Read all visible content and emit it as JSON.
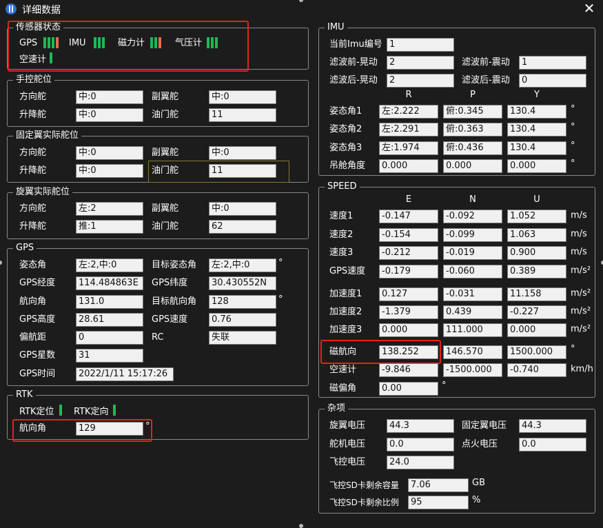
{
  "window": {
    "title": "详细数据",
    "close_glyph": "✕"
  },
  "sensor_status": {
    "title": "传感器状态",
    "gps": "GPS",
    "imu": "IMU",
    "mag": "磁力计",
    "baro": "气压计",
    "airspeed": "空速计",
    "colors": {
      "ok": "#1db954",
      "warn": "#e86a4d"
    }
  },
  "manual": {
    "title": "手控舵位",
    "rudder_label": "方向舵",
    "rudder": "中:0",
    "aileron_label": "副翼舵",
    "aileron": "中:0",
    "elevator_label": "升降舵",
    "elevator": "中:0",
    "throttle_label": "油门舵",
    "throttle": "11"
  },
  "fixed": {
    "title": "固定翼实际舵位",
    "rudder_label": "方向舵",
    "rudder": "中:0",
    "aileron_label": "副翼舵",
    "aileron": "中:0",
    "elevator_label": "升降舵",
    "elevator": "中:0",
    "throttle_label": "油门舵",
    "throttle": "11"
  },
  "rotor": {
    "title": "旋翼实际舵位",
    "rudder_label": "方向舵",
    "rudder": "左:2",
    "aileron_label": "副翼舵",
    "aileron": "中:0",
    "elevator_label": "升降舵",
    "elevator": "推:1",
    "throttle_label": "油门舵",
    "throttle": "62"
  },
  "gps": {
    "title": "GPS",
    "attitude_label": "姿态角",
    "attitude": "左:2,中:0",
    "target_attitude_label": "目标姿态角",
    "target_attitude": "左:2,中:0",
    "lon_label": "GPS经度",
    "lon": "114.484863E",
    "lat_label": "GPS纬度",
    "lat": "30.430552N",
    "heading_label": "航向角",
    "heading": "131.0",
    "target_heading_label": "目标航向角",
    "target_heading": "128",
    "alt_label": "GPS高度",
    "alt": "28.61",
    "speed_label": "GPS速度",
    "speed": "0.76",
    "offset_label": "偏航距",
    "offset": "0",
    "rc_label": "RC",
    "rc": "失联",
    "sats_label": "GPS星数",
    "sats": "31",
    "time_label": "GPS时间",
    "time": "2022/1/11 15:17:26",
    "deg": "°"
  },
  "rtk": {
    "title": "RTK",
    "pos_label": "RTK定位",
    "dir_label": "RTK定向",
    "heading_label": "航向角",
    "heading": "129",
    "deg": "°"
  },
  "imu": {
    "title": "IMU",
    "current_label": "当前Imu编号",
    "current": "1",
    "pre_shake_label": "滤波前-晃动",
    "pre_shake": "2",
    "pre_vib_label": "滤波前-震动",
    "pre_vib": "1",
    "post_shake_label": "滤波后-晃动",
    "post_shake": "2",
    "post_vib_label": "滤波后-震动",
    "post_vib": "0",
    "col_r": "R",
    "col_p": "P",
    "col_y": "Y",
    "att1_label": "姿态角1",
    "att1_r": "左:2.222",
    "att1_p": "俯:0.345",
    "att1_y": "130.4",
    "att2_label": "姿态角2",
    "att2_r": "左:2.291",
    "att2_p": "俯:0.363",
    "att2_y": "130.4",
    "att3_label": "姿态角3",
    "att3_r": "左:1.974",
    "att3_p": "俯:0.436",
    "att3_y": "130.4",
    "pod_label": "吊舱角度",
    "pod_r": "0.000",
    "pod_p": "0.000",
    "pod_y": "0.000",
    "deg": "°"
  },
  "speed": {
    "title": "SPEED",
    "col_e": "E",
    "col_n": "N",
    "col_u": "U",
    "v1_label": "速度1",
    "v1_e": "-0.147",
    "v1_n": "-0.092",
    "v1_u": "1.052",
    "v2_label": "速度2",
    "v2_e": "-0.154",
    "v2_n": "-0.099",
    "v2_u": "1.063",
    "v3_label": "速度3",
    "v3_e": "-0.212",
    "v3_n": "-0.019",
    "v3_u": "0.900",
    "gpsv_label": "GPS速度",
    "gpsv_e": "-0.179",
    "gpsv_n": "-0.060",
    "gpsv_u": "0.389",
    "a1_label": "加速度1",
    "a1_e": "0.127",
    "a1_n": "-0.031",
    "a1_u": "11.158",
    "a2_label": "加速度2",
    "a2_e": "-1.379",
    "a2_n": "0.439",
    "a2_u": "-0.227",
    "a3_label": "加速度3",
    "a3_e": "0.000",
    "a3_n": "111.000",
    "a3_u": "0.000",
    "mag_label": "磁航向",
    "mag_e": "138.252",
    "mag_n": "146.570",
    "mag_u": "1500.000",
    "air_label": "空速计",
    "air_e": "-9.846",
    "air_n": "-1500.000",
    "air_u": "-0.740",
    "decl_label": "磁偏角",
    "decl": "0.00",
    "unit_ms": "m/s",
    "unit_ms2": "m/s²",
    "unit_deg": "°",
    "unit_kmh": "km/h"
  },
  "misc": {
    "title": "杂项",
    "rotor_v_label": "旋翼电压",
    "rotor_v": "44.3",
    "fixed_v_label": "固定翼电压",
    "fixed_v": "44.3",
    "servo_v_label": "舵机电压",
    "servo_v": "0.0",
    "ignite_v_label": "点火电压",
    "ignite_v": "0.0",
    "fc_v_label": "飞控电压",
    "fc_v": "24.0",
    "sd_cap_label": "飞控SD卡剩余容量",
    "sd_cap": "7.06",
    "sd_cap_unit": "GB",
    "sd_ratio_label": "飞控SD卡剩余比例",
    "sd_ratio": "95",
    "sd_ratio_unit": "%"
  }
}
